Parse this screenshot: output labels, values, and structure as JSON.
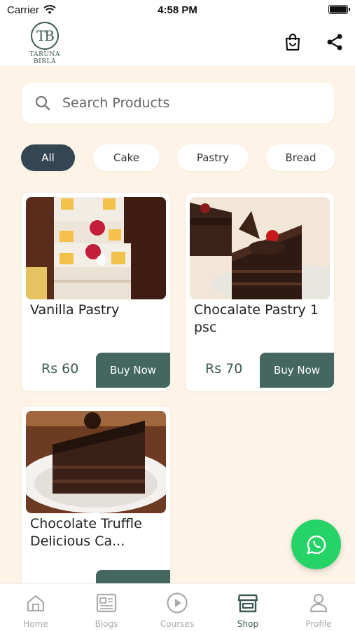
{
  "status_bar": {
    "carrier": "Carrier",
    "time": "4:58 PM"
  },
  "header": {
    "logo_monogram": "TB",
    "logo_text": "TARUNA BIRLA"
  },
  "search": {
    "placeholder": "Search Products",
    "value": ""
  },
  "categories": [
    {
      "label": "All",
      "selected": true
    },
    {
      "label": "Cake",
      "selected": false
    },
    {
      "label": "Pastry",
      "selected": false
    },
    {
      "label": "Bread",
      "selected": false
    }
  ],
  "products": [
    {
      "title": "Vanilla Pastry",
      "price": "Rs 60",
      "button": "Buy Now"
    },
    {
      "title": "Chocalate Pastry 1 psc",
      "price": "Rs 70",
      "button": "Buy Now"
    },
    {
      "title": "Chocolate Truffle Delicious Ca...",
      "price": "",
      "button": ""
    }
  ],
  "bottom_nav": [
    {
      "label": "Home",
      "icon": "home-icon",
      "active": false
    },
    {
      "label": "Blogs",
      "icon": "blogs-icon",
      "active": false
    },
    {
      "label": "Courses",
      "icon": "play-icon",
      "active": false
    },
    {
      "label": "Shop",
      "icon": "shop-icon",
      "active": true
    },
    {
      "label": "Profile",
      "icon": "profile-icon",
      "active": false
    }
  ],
  "colors": {
    "background": "#fdf3e6",
    "accent": "#44675f",
    "chip_active": "#334652",
    "whatsapp": "#25d366"
  }
}
